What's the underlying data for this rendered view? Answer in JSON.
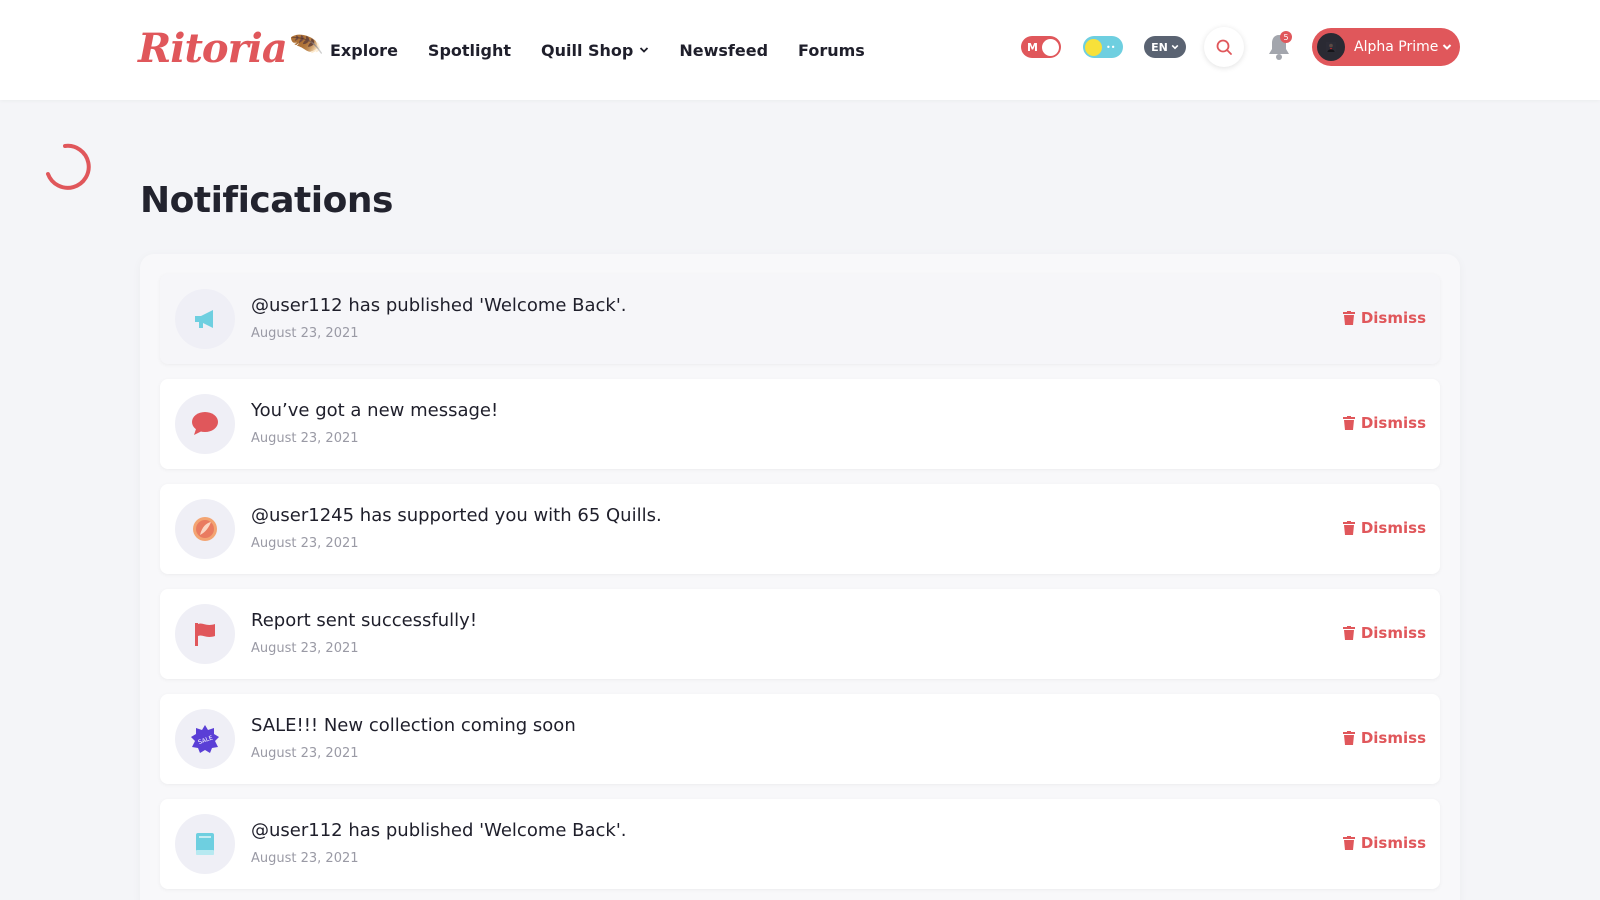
{
  "brand": {
    "logo_text": "Ritoria",
    "accent": "#e0575b"
  },
  "nav": {
    "items": [
      {
        "label": "Explore"
      },
      {
        "label": "Spotlight"
      },
      {
        "label": "Quill Shop",
        "has_dropdown": true
      },
      {
        "label": "Newsfeed"
      },
      {
        "label": "Forums"
      }
    ]
  },
  "header": {
    "mature_toggle_label": "M",
    "language": "EN",
    "notification_count": "5",
    "user_name": "Alpha Prime"
  },
  "page": {
    "title": "Notifications"
  },
  "notifications": [
    {
      "user": "@user112",
      "message": " has published 'Welcome Back'.",
      "date": "August 23, 2021",
      "icon": "megaphone-icon",
      "dismiss": "Dismiss"
    },
    {
      "user": "",
      "message": "You’ve got a new message!",
      "date": "August 23, 2021",
      "icon": "chat-bubble-icon",
      "dismiss": "Dismiss"
    },
    {
      "user": "@user1245",
      "message": " has supported you with 65 Quills.",
      "date": "August 23, 2021",
      "icon": "quill-coin-icon",
      "dismiss": "Dismiss"
    },
    {
      "user": "",
      "message": "Report sent successfully!",
      "date": "August 23, 2021",
      "icon": "flag-icon",
      "dismiss": "Dismiss"
    },
    {
      "user": "",
      "message": "SALE!!! New collection coming soon",
      "date": "August 23, 2021",
      "icon": "sale-badge-icon",
      "dismiss": "Dismiss"
    },
    {
      "user": "@user112",
      "message": " has published 'Welcome Back'.",
      "date": "August 23, 2021",
      "icon": "book-icon",
      "dismiss": "Dismiss"
    }
  ]
}
